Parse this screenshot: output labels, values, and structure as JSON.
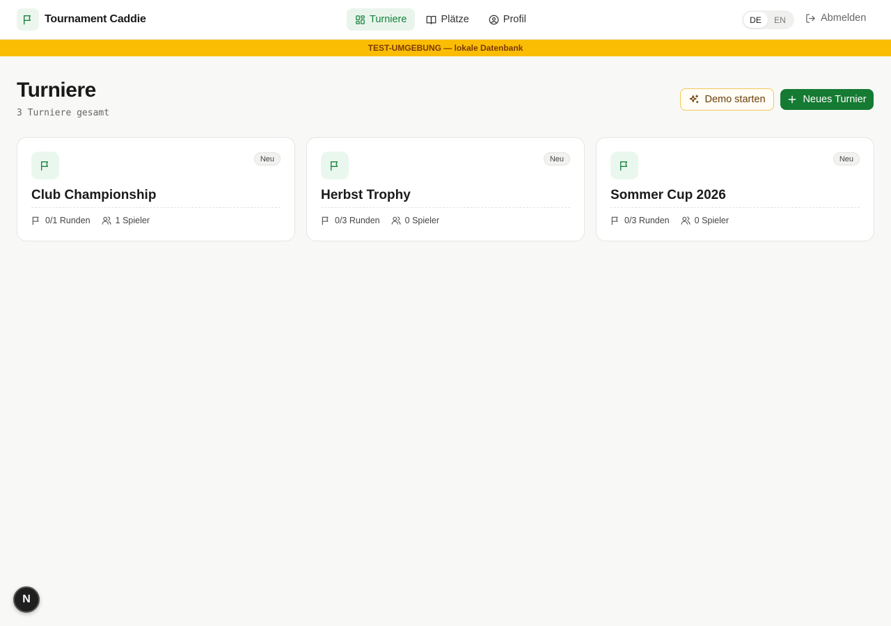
{
  "header": {
    "brand_name": "Tournament Caddie",
    "nav": [
      {
        "label": "Turniere",
        "icon": "grid-icon",
        "active": true
      },
      {
        "label": "Plätze",
        "icon": "book-icon",
        "active": false
      },
      {
        "label": "Profil",
        "icon": "user-circle-icon",
        "active": false
      }
    ],
    "lang": {
      "de": "DE",
      "en": "EN",
      "active": "DE"
    },
    "logout_label": "Abmelden"
  },
  "banner": {
    "text": "TEST-UMGEBUNG — lokale Datenbank",
    "color": "#fbbc04"
  },
  "page": {
    "title": "Turniere",
    "subtitle": "3 Turniere gesamt",
    "demo_button": "Demo starten",
    "new_button": "Neues Turnier"
  },
  "tournaments": [
    {
      "title": "Club Championship",
      "badge": "Neu",
      "rounds": "0/1 Runden",
      "players": "1 Spieler"
    },
    {
      "title": "Herbst Trophy",
      "badge": "Neu",
      "rounds": "0/3 Runden",
      "players": "0 Spieler"
    },
    {
      "title": "Sommer Cup 2026",
      "badge": "Neu",
      "rounds": "0/3 Runden",
      "players": "0 Spieler"
    }
  ],
  "fab_label": "N",
  "colors": {
    "accent": "#157a32",
    "accent_light": "#eaf7ee",
    "banner": "#fbbc04"
  }
}
